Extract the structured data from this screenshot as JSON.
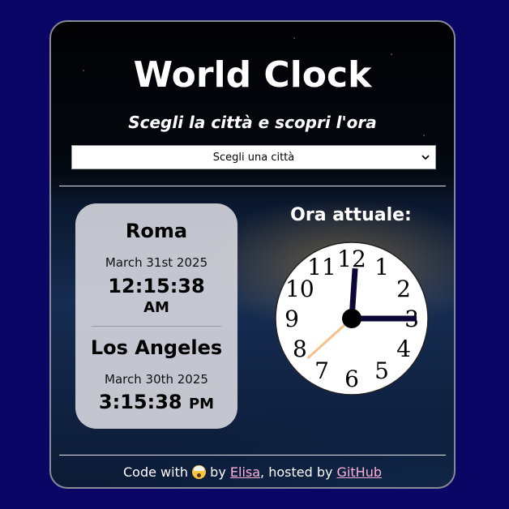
{
  "header": {
    "title": "World Clock",
    "subtitle": "Scegli la città e scopri l'ora"
  },
  "city_select": {
    "selected": "Scegli una città"
  },
  "times": [
    {
      "city": "Roma",
      "date": "March 31st 2025",
      "time": "12:15:38",
      "ampm": "AM"
    },
    {
      "city": "Los Angeles",
      "date": "March 30th 2025",
      "time": "3:15:38",
      "ampm": "PM"
    }
  ],
  "clock": {
    "label": "Ora attuale:",
    "numbers": [
      "12",
      "1",
      "2",
      "3",
      "4",
      "5",
      "6",
      "7",
      "8",
      "9",
      "10",
      "11"
    ],
    "time": {
      "hours": 3,
      "minutes": 0,
      "seconds": 38
    },
    "colors": {
      "hands": "#0b0838",
      "second_hand": "#f5c08a",
      "face": "#ffffff"
    }
  },
  "footer": {
    "prefix": "Code with",
    "emoji": "exploding-head-icon",
    "by": "by",
    "author": "Elisa",
    "middle": ", hosted by",
    "host": "GitHub"
  },
  "colors": {
    "page_bg": "#0a0666",
    "link": "#ffb0d8"
  }
}
